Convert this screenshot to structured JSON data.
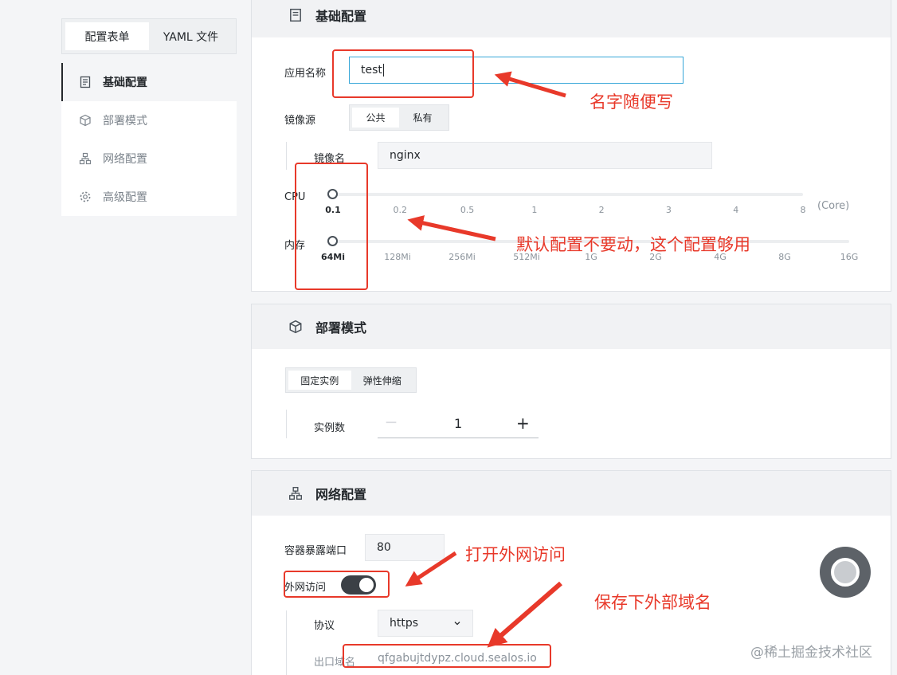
{
  "mode_tabs": {
    "form": "配置表单",
    "yaml": "YAML 文件"
  },
  "nav": {
    "basic": "基础配置",
    "deploy": "部署模式",
    "network": "网络配置",
    "advanced": "高级配置"
  },
  "basic": {
    "app_name_label": "应用名称",
    "app_name_value": "test",
    "image_source_label": "镜像源",
    "image_source_public": "公共",
    "image_source_private": "私有",
    "image_name_label": "镜像名",
    "image_name_value": "nginx",
    "cpu_label": "CPU",
    "cpu_ticks": [
      "0.1",
      "0.2",
      "0.5",
      "1",
      "2",
      "3",
      "4",
      "8"
    ],
    "cpu_unit": "(Core)",
    "cpu_selected": "0.1",
    "mem_label": "内存",
    "mem_ticks": [
      "64Mi",
      "128Mi",
      "256Mi",
      "512Mi",
      "1G",
      "2G",
      "4G",
      "8G",
      "16G"
    ],
    "mem_selected": "64Mi"
  },
  "deploy": {
    "title": "部署模式",
    "fixed": "固定实例",
    "elastic": "弹性伸缩",
    "instances_label": "实例数",
    "instances_value": "1",
    "minus": "—",
    "plus": "+"
  },
  "network": {
    "title": "网络配置",
    "port_label": "容器暴露端口",
    "port_value": "80",
    "public_label": "外网访问",
    "public_on": true,
    "protocol_label": "协议",
    "protocol_value": "https",
    "domain_label": "出口域名",
    "domain_value": "qfgabujtdypz.cloud.sealos.io"
  },
  "annotations": {
    "name": "名字随便写",
    "defaults": "默认配置不要动，这个配置够用",
    "public": "打开外网访问",
    "domain": "保存下外部域名"
  },
  "watermark": "@稀土掘金技术社区",
  "colors": {
    "annotation": "#e8392a",
    "input_focus": "#36a6d8",
    "toggle": "#3b4046"
  }
}
